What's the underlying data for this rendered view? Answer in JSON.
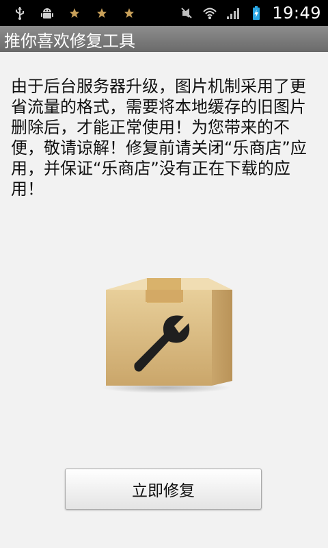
{
  "status_bar": {
    "icons_left": [
      "usb-icon",
      "android-debug-icon",
      "star-icon",
      "star-icon",
      "star-icon"
    ],
    "icons_right": [
      "mute-icon",
      "wifi-icon",
      "signal-icon",
      "battery-charging-icon"
    ],
    "time": "19:49"
  },
  "app": {
    "title": "推你喜欢修复工具"
  },
  "main": {
    "message": "由于后台服务器升级，图片机制采用了更省流量的格式，需要将本地缓存的旧图片删除后，才能正常使用！为您带来的不便，敬请谅解！修复前请关闭“乐商店”应用，并保证“乐商店”没有正在下载的应用！",
    "illustration_icon": "toolbox-wrench-icon",
    "repair_button_label": "立即修复"
  },
  "colors": {
    "status_bar_bg": "#000000",
    "title_bar_bg": "#7b7b7b",
    "content_bg": "#f2f2f2",
    "box_color": "#d7b77a",
    "clock_color": "#ffffff"
  }
}
